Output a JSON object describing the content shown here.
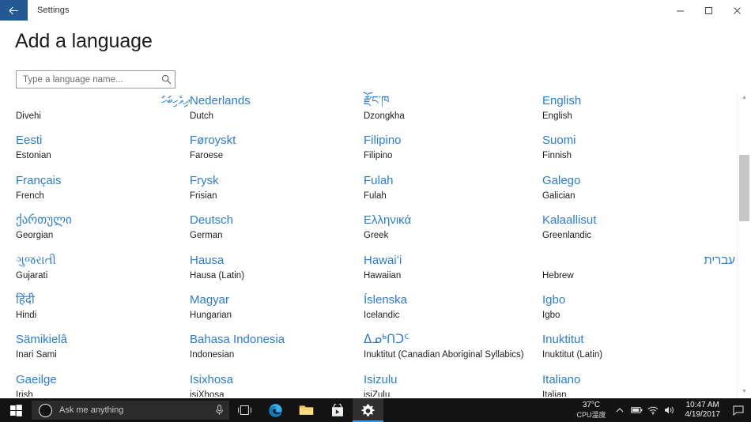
{
  "titlebar": {
    "back_icon": "back-arrow-icon",
    "title": "Settings",
    "minimize_label": "–",
    "maximize_label": "❐",
    "close_label": "✕"
  },
  "page": {
    "heading": "Add a language"
  },
  "search": {
    "placeholder": "Type a language name...",
    "value": "",
    "icon": "search-icon"
  },
  "colors": {
    "accent_link": "#2b7cd3",
    "back_button_bg": "#245a94",
    "taskbar_bg": "#131313",
    "taskbar_active_underline": "#3d9ae0",
    "scrollbar_thumb": "#c6c6c6"
  },
  "languages": [
    {
      "native": "ދިވެހިބަހު",
      "english": "Divehi",
      "rtl": true
    },
    {
      "native": "Nederlands",
      "english": "Dutch",
      "rtl": false
    },
    {
      "native": "རྫོང་ཁ",
      "english": "Dzongkha",
      "rtl": false
    },
    {
      "native": "English",
      "english": "English",
      "rtl": false
    },
    {
      "native": "Eesti",
      "english": "Estonian",
      "rtl": false
    },
    {
      "native": "Føroyskt",
      "english": "Faroese",
      "rtl": false
    },
    {
      "native": "Filipino",
      "english": "Filipino",
      "rtl": false
    },
    {
      "native": "Suomi",
      "english": "Finnish",
      "rtl": false
    },
    {
      "native": "Français",
      "english": "French",
      "rtl": false
    },
    {
      "native": "Frysk",
      "english": "Frisian",
      "rtl": false
    },
    {
      "native": "Fulah",
      "english": "Fulah",
      "rtl": false
    },
    {
      "native": "Galego",
      "english": "Galician",
      "rtl": false
    },
    {
      "native": "ქართული",
      "english": "Georgian",
      "rtl": false
    },
    {
      "native": "Deutsch",
      "english": "German",
      "rtl": false
    },
    {
      "native": "Ελληνικά",
      "english": "Greek",
      "rtl": false
    },
    {
      "native": "Kalaallisut",
      "english": "Greenlandic",
      "rtl": false
    },
    {
      "native": "ગુજરાતી",
      "english": "Gujarati",
      "rtl": false
    },
    {
      "native": "Hausa",
      "english": "Hausa (Latin)",
      "rtl": false
    },
    {
      "native": "Hawaiʻi",
      "english": "Hawaiian",
      "rtl": false
    },
    {
      "native": "עברית",
      "english": "Hebrew",
      "rtl": true
    },
    {
      "native": "हिंदी",
      "english": "Hindi",
      "rtl": false
    },
    {
      "native": "Magyar",
      "english": "Hungarian",
      "rtl": false
    },
    {
      "native": "Íslenska",
      "english": "Icelandic",
      "rtl": false
    },
    {
      "native": "Igbo",
      "english": "Igbo",
      "rtl": false
    },
    {
      "native": "Sämikielâ",
      "english": "Inari Sami",
      "rtl": false
    },
    {
      "native": "Bahasa Indonesia",
      "english": "Indonesian",
      "rtl": false
    },
    {
      "native": "ᐃᓄᒃᑎᑐᑦ",
      "english": "Inuktitut (Canadian Aboriginal Syllabics)",
      "rtl": false
    },
    {
      "native": "Inuktitut",
      "english": "Inuktitut (Latin)",
      "rtl": false
    },
    {
      "native": "Gaeilge",
      "english": "Irish",
      "rtl": false
    },
    {
      "native": "Isixhosa",
      "english": "isiXhosa",
      "rtl": false
    },
    {
      "native": "Isizulu",
      "english": "isiZulu",
      "rtl": false
    },
    {
      "native": "Italiano",
      "english": "Italian",
      "rtl": false
    }
  ],
  "scrollbar": {
    "up_arrow": "▲",
    "down_arrow": "▼"
  },
  "taskbar": {
    "start_icon": "windows-start-icon",
    "search_placeholder": "Ask me anything",
    "mic_icon": "microphone-icon",
    "apps": [
      {
        "name": "task-view",
        "icon": "task-view-icon",
        "active": false
      },
      {
        "name": "edge",
        "icon": "edge-browser-icon",
        "active": false
      },
      {
        "name": "file-explorer",
        "icon": "file-explorer-icon",
        "active": false
      },
      {
        "name": "store",
        "icon": "microsoft-store-icon",
        "active": false
      },
      {
        "name": "settings",
        "icon": "settings-gear-icon",
        "active": true
      }
    ],
    "tray": {
      "cpu_temp_value": "37°C",
      "cpu_temp_label": "CPU温度",
      "chevron_icon": "show-hidden-icons-chevron",
      "battery_icon": "battery-icon",
      "network_icon": "wifi-icon",
      "volume_icon": "speaker-icon",
      "time": "10:47 AM",
      "date": "4/19/2017",
      "action_center_icon": "action-center-icon"
    }
  }
}
